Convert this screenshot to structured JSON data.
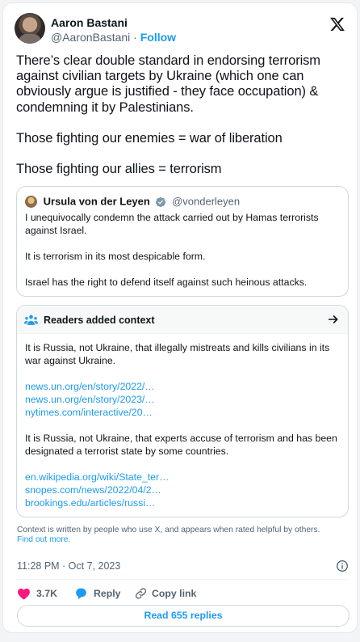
{
  "author": {
    "name": "Aaron Bastani",
    "handle": "@AaronBastani",
    "separator": "·",
    "follow_label": "Follow"
  },
  "tweet": {
    "paragraphs": [
      "There’s clear double standard in endorsing terrorism against civilian targets by Ukraine (which one can obviously argue is justified - they face occupation) & condemning it by Palestinians.",
      "Those fighting our enemies = war of liberation",
      "Those fighting our allies = terrorism"
    ]
  },
  "quoted": {
    "name": "Ursula von der Leyen",
    "handle": "@vonderleyen",
    "paragraphs": [
      "I unequivocally condemn the attack carried out by Hamas terrorists against Israel.",
      "It is terrorism in its most despicable form.",
      "Israel has the right to defend itself against such heinous attacks."
    ]
  },
  "context_note": {
    "title": "Readers added context",
    "para1": "It is Russia, not Ukraine, that illegally mistreats and kills civilians in its war against Ukraine.",
    "links1": [
      "news.un.org/en/story/2022/…",
      "news.un.org/en/story/2023/…",
      "nytimes.com/interactive/20…"
    ],
    "para2": "It is Russia, not Ukraine, that experts accuse of terrorism and has been designated a terrorist state by some countries.",
    "links2": [
      "en.wikipedia.org/wiki/State_ter…",
      "snopes.com/news/2022/04/2…",
      "brookings.edu/articles/russi…"
    ]
  },
  "disclaimer": {
    "text": "Context is written by people who use X, and appears when rated helpful by others.",
    "link": "Find out more."
  },
  "timestamp": "11:28 PM · Oct 7, 2023",
  "actions": {
    "likes": "3.7K",
    "reply_label": "Reply",
    "copy_label": "Copy link"
  },
  "read_replies_label": "Read 655 replies",
  "colors": {
    "accent": "#1d9bf0",
    "like": "#f91880",
    "verified": "#829aab",
    "text": "#0f1419",
    "muted": "#536471"
  }
}
